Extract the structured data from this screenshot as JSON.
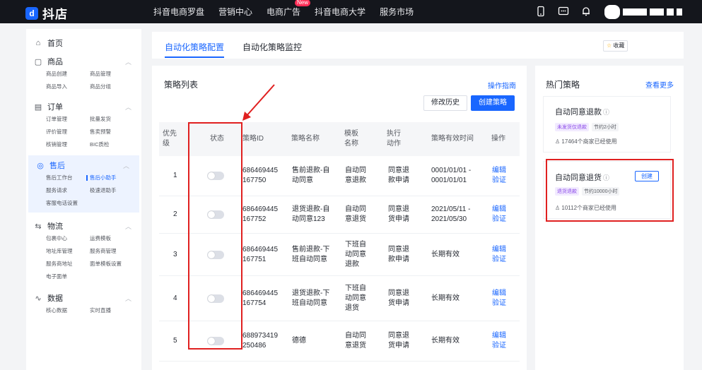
{
  "app": {
    "logo_text": "抖店"
  },
  "topnav": {
    "items": [
      "抖音电商罗盘",
      "营销中心",
      "电商广告",
      "抖音电商大学",
      "服务市场"
    ],
    "new_badge": "New"
  },
  "sidebar": {
    "groups": [
      {
        "title": "首页",
        "icon": "home-icon",
        "items": []
      },
      {
        "title": "商品",
        "icon": "shopping-bag-icon",
        "items": [
          "商品创建",
          "商品管理",
          "商品导入",
          "商品分组"
        ]
      },
      {
        "title": "订单",
        "icon": "order-icon",
        "items": [
          "订单管理",
          "批量发货",
          "评价管理",
          "售卖预警",
          "核销管理",
          "BIC质检"
        ]
      },
      {
        "title": "售后",
        "icon": "after-sales-icon",
        "items": [
          "售后工作台",
          "售后小助手",
          "服务请求",
          "极速退助手",
          "客服电话设置"
        ],
        "active": true
      },
      {
        "title": "物流",
        "icon": "truck-icon",
        "items": [
          "包裹中心",
          "运费模板",
          "地址库管理",
          "服务商管理",
          "服务商地址",
          "面单模板设置",
          "电子面单"
        ]
      },
      {
        "title": "数据",
        "icon": "data-icon",
        "items": [
          "核心数据",
          "实时直播"
        ]
      }
    ],
    "current_item": "售后小助手"
  },
  "tabs": {
    "items": [
      "自动化策略配置",
      "自动化策略监控"
    ],
    "active": 0,
    "favorite_label": "收藏"
  },
  "strategy_list": {
    "title": "策略列表",
    "guide_link": "操作指南",
    "history_button": "修改历史",
    "create_button": "创建策略",
    "columns": [
      "优先级",
      "状态",
      "策略ID",
      "策略名称",
      "模板名称",
      "执行动作",
      "策略有效时间",
      "操作"
    ],
    "rows": [
      {
        "priority": "1",
        "id": "686469445\n167750",
        "name": "售前退款-自\n动同意",
        "template": "自动同\n意退款",
        "action": "同意退\n款申请",
        "valid": "0001/01/01 -\n0001/01/01",
        "ops": [
          "编辑",
          "验证"
        ]
      },
      {
        "priority": "2",
        "id": "686469445\n167752",
        "name": "退货退款-自\n动同意123",
        "template": "自动同\n意退货",
        "action": "同意退\n货申请",
        "valid": "2021/05/11 -\n2021/05/30",
        "ops": [
          "编辑",
          "验证"
        ]
      },
      {
        "priority": "3",
        "id": "686469445\n167751",
        "name": "售前退款-下\n班自动同意",
        "template": "下班自\n动同意\n退款",
        "action": "同意退\n款申请",
        "valid": "长期有效",
        "ops": [
          "编辑",
          "验证"
        ]
      },
      {
        "priority": "4",
        "id": "686469445\n167754",
        "name": "退货退款-下\n班自动同意",
        "template": "下班自\n动同意\n退货",
        "action": "同意退\n货申请",
        "valid": "长期有效",
        "ops": [
          "编辑",
          "验证"
        ]
      },
      {
        "priority": "5",
        "id": "688973419\n250486",
        "name": "德德",
        "template": "自动同\n意退货",
        "action": "同意退\n货申请",
        "valid": "长期有效",
        "ops": [
          "编辑",
          "验证"
        ]
      }
    ]
  },
  "hot": {
    "title": "热门策略",
    "more_link": "查看更多",
    "cards": [
      {
        "name": "自动同意退款",
        "tags": [
          "未发货仅退款",
          "节约2小时"
        ],
        "users": "17464个商家已经使用"
      },
      {
        "name": "自动同意退货",
        "tags": [
          "退货退款",
          "节约10000小时"
        ],
        "users": "10112个商家已经使用",
        "create_label": "创建"
      }
    ]
  },
  "colors": {
    "accent": "#1966ff",
    "annotation": "#e02020",
    "topbar": "#14161c"
  }
}
